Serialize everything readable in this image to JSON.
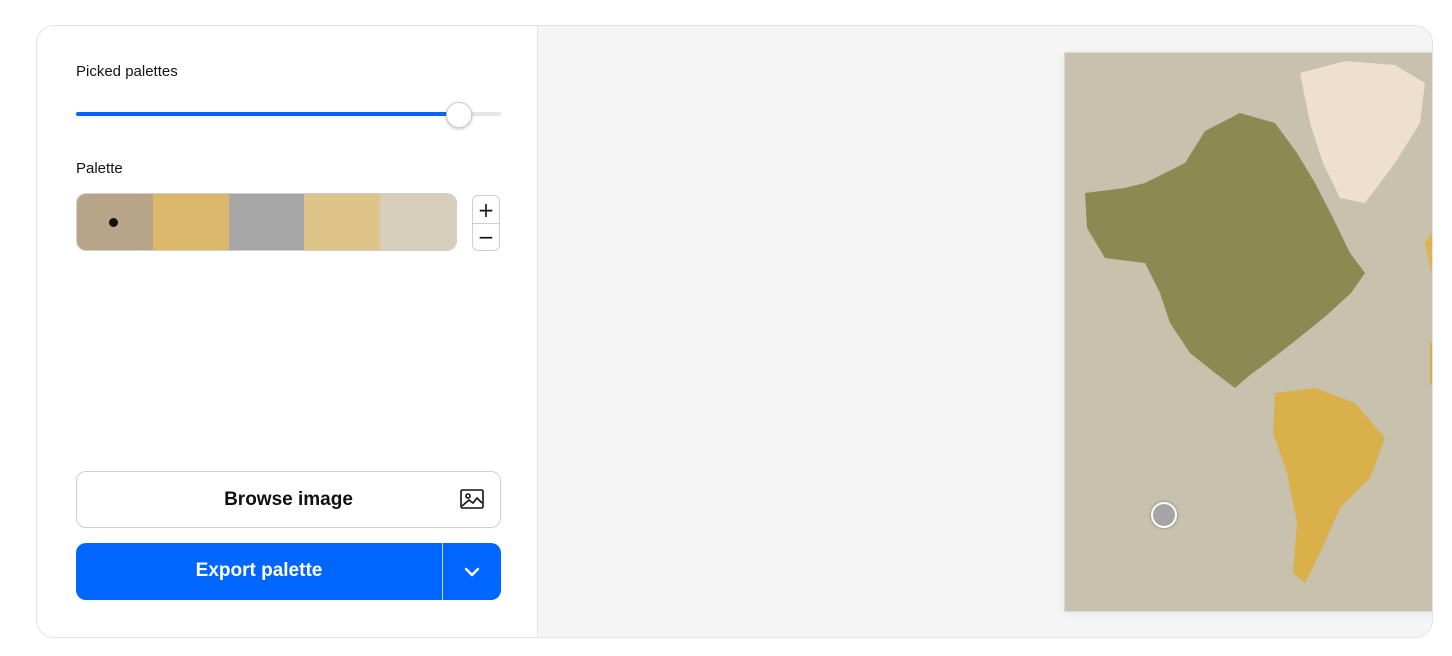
{
  "controls": {
    "picked_palettes_label": "Picked palettes",
    "picked_palettes_slider": {
      "level": 0.9
    },
    "palette_label": "Palette",
    "plus_label": "+",
    "minus_label": "−"
  },
  "palette": [
    {
      "color": "#b7a489",
      "selected": true
    },
    {
      "color": "#dcb86c",
      "selected": false
    },
    {
      "color": "#a7a7a7",
      "selected": false
    },
    {
      "color": "#dec489",
      "selected": false
    },
    {
      "color": "#d6cebb",
      "selected": false
    }
  ],
  "buttons": {
    "browse_label": "Browse image",
    "export_label": "Export palette"
  },
  "colors": {
    "accent": "#0066ff",
    "ocean": "#c7c1ad",
    "north_america": "#8b8a52",
    "greenland": "#efe0cd",
    "eurasia": "#d9b54e",
    "africa": "#d3ad47",
    "south_america": "#d9b04a",
    "australia": "#e0bb55"
  },
  "picker_colors": [
    "#dcc08a",
    "#d8b77a",
    "#a5a5a5",
    "#a9a9a9",
    "#b7a489"
  ]
}
